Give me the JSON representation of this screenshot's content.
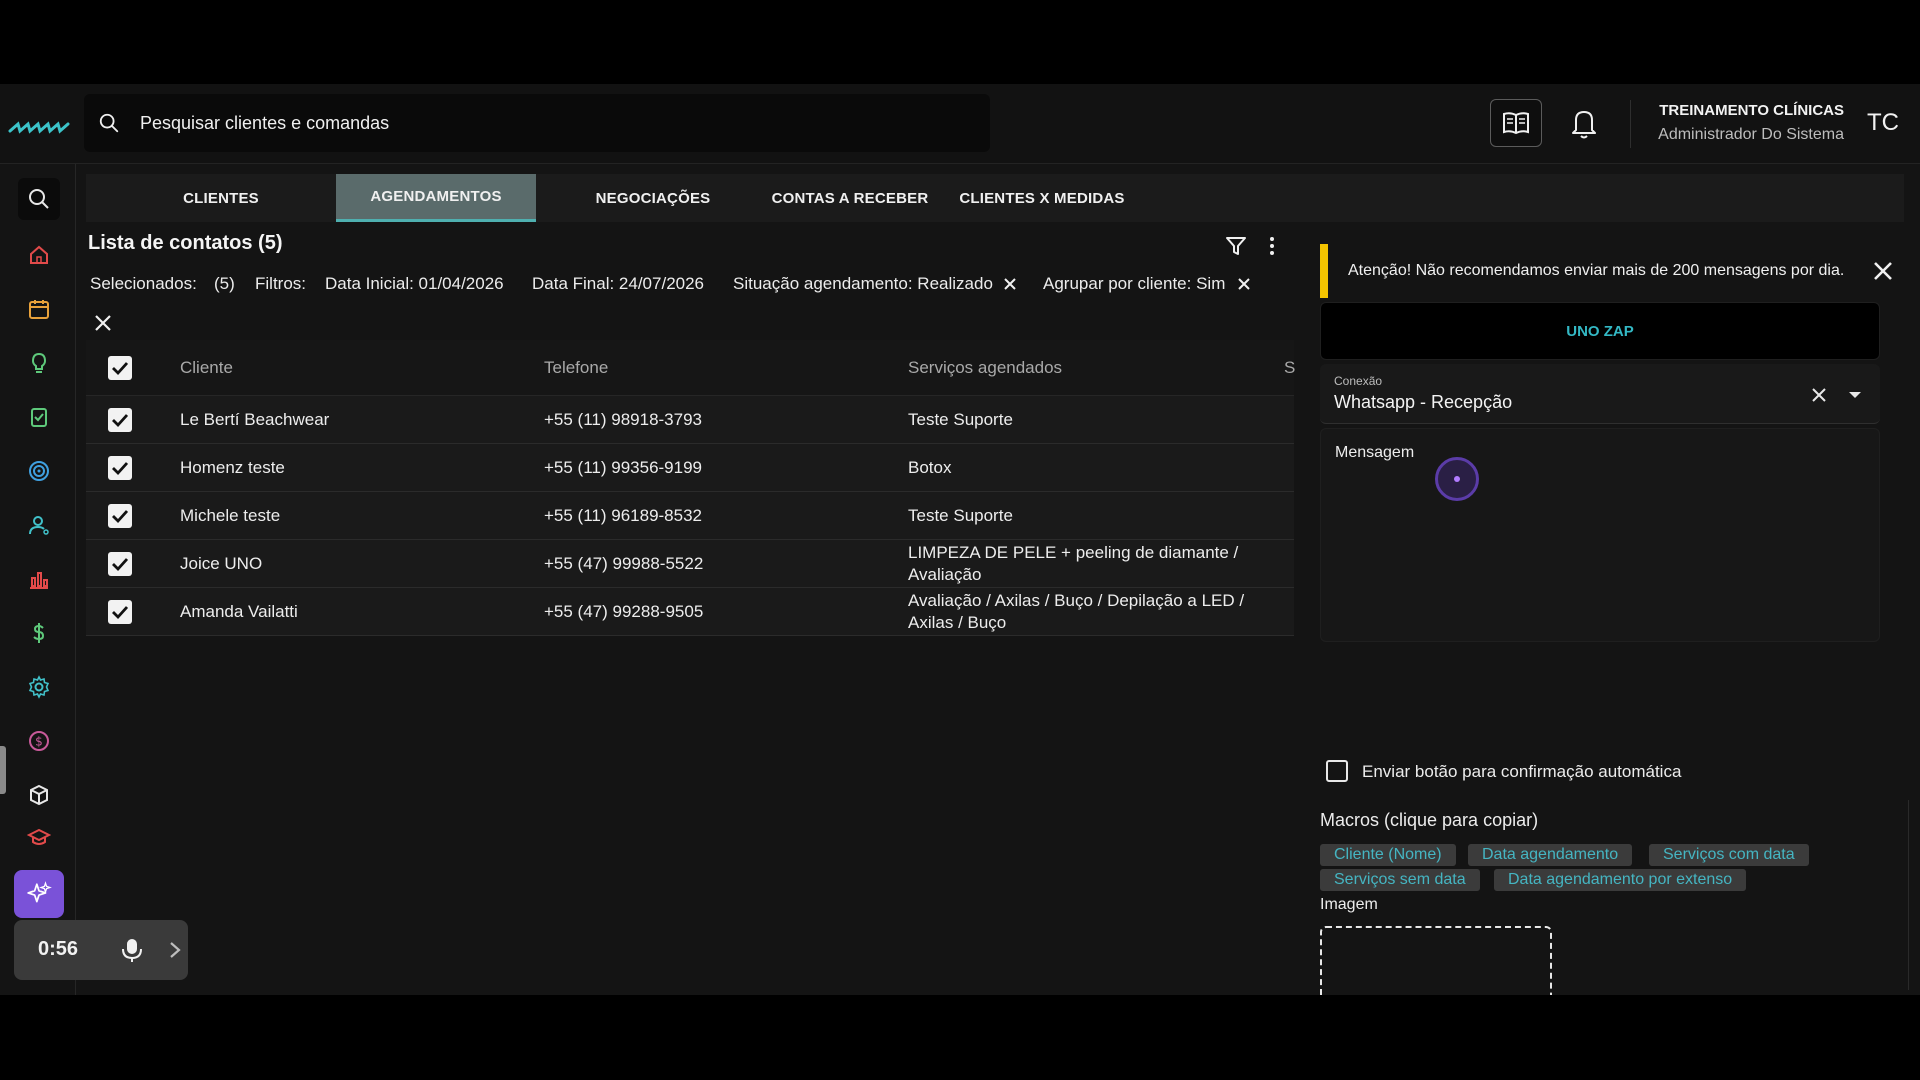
{
  "header": {
    "search_placeholder": "Pesquisar clientes e comandas",
    "user_name": "TREINAMENTO CLÍNICAS",
    "user_role": "Administrador Do Sistema",
    "avatar_initials": "TC"
  },
  "sidebar": {
    "items": [
      "search-icon",
      "home-icon",
      "calendar-icon",
      "lightbulb-icon",
      "clipboard-check-icon",
      "target-icon",
      "user-icon",
      "bar-chart-icon",
      "dollar-icon",
      "gear-icon",
      "coin-icon",
      "box-icon",
      "graduation-icon"
    ],
    "active": "gear-icon",
    "ai_button": "sparkles-icon"
  },
  "recorder": {
    "time": "0:56"
  },
  "tabs": [
    {
      "label": "CLIENTES"
    },
    {
      "label": "AGENDAMENTOS"
    },
    {
      "label": "NEGOCIAÇÕES"
    },
    {
      "label": "CONTAS A RECEBER"
    },
    {
      "label": "CLIENTES X MEDIDAS"
    }
  ],
  "active_tab": "AGENDAMENTOS",
  "list": {
    "title": "Lista de contatos (5)",
    "selected_label": "Selecionados:",
    "selected_count": "(5)",
    "filters_label": "Filtros:",
    "filter_start": "Data Inicial: 01/04/2026",
    "filter_end": "Data Final: 24/07/2026",
    "filter_status": "Situação agendamento: Realizado",
    "filter_group": "Agrupar por cliente: Sim"
  },
  "table": {
    "columns": [
      "Cliente",
      "Telefone",
      "Serviços agendados",
      "S"
    ],
    "rows": [
      {
        "cliente": "Le Bertí Beachwear",
        "telefone": "+55 (11) 98918-3793",
        "servicos": [
          "Teste Suporte"
        ]
      },
      {
        "cliente": "Homenz teste",
        "telefone": "+55 (11) 99356-9199",
        "servicos": [
          "Botox"
        ]
      },
      {
        "cliente": "Michele teste",
        "telefone": "+55 (11) 96189-8532",
        "servicos": [
          "Teste Suporte"
        ]
      },
      {
        "cliente": "Joice UNO",
        "telefone": "+55 (47) 99988-5522",
        "servicos": [
          "LIMPEZA DE PELE + peeling de diamante /",
          "Avaliação"
        ]
      },
      {
        "cliente": "Amanda Vailatti",
        "telefone": "+55 (47) 99288-9505",
        "servicos": [
          "Avaliação / Axilas / Buço / Depilação a LED /",
          "Axilas / Buço"
        ]
      }
    ]
  },
  "panel": {
    "warning": "Atenção! Não recomendamos enviar mais de 200 mensagens por dia.",
    "provider_button": "UNO ZAP",
    "connection_label": "Conexão",
    "connection_value": "Whatsapp - Recepção",
    "message_label": "Mensagem",
    "confirm_label": "Enviar botão para confirmação automática",
    "macros_title": "Macros (clique para copiar)",
    "macros": [
      "Cliente (Nome)",
      "Data agendamento",
      "Serviços com data",
      "Serviços sem data",
      "Data agendamento por extenso"
    ],
    "image_label": "Imagem"
  },
  "colors": {
    "accent_teal": "#4fb0b0",
    "warning_yellow": "#f4c400",
    "ai_purple": "#7a52d8",
    "macro_text": "#45b5c2"
  }
}
